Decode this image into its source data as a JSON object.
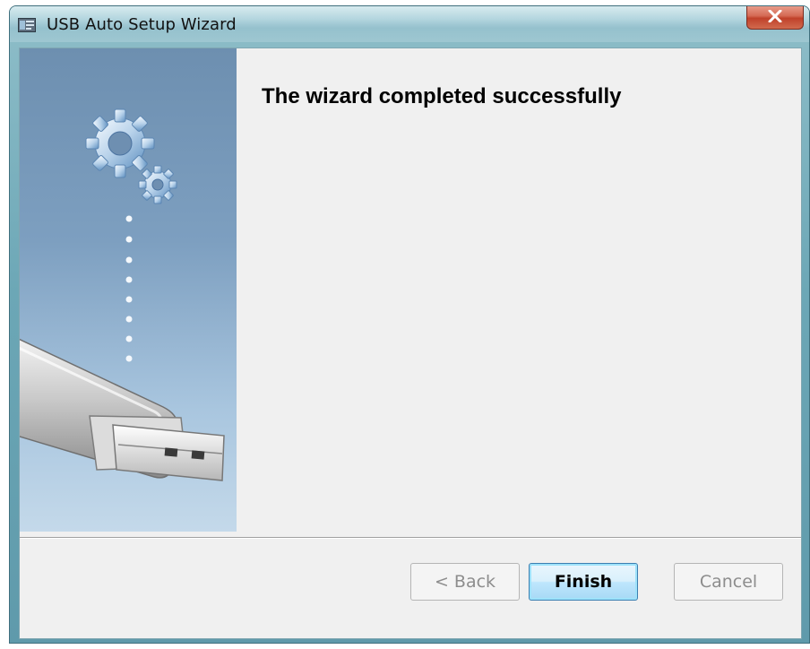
{
  "window": {
    "title": "USB Auto Setup Wizard",
    "title_icon": "wizard-app-icon",
    "close_icon": "close-icon"
  },
  "banner": {
    "gear_icon": "gears-icon",
    "usb_icon": "usb-drive-icon",
    "dots_icon": "progress-dots"
  },
  "content": {
    "heading": "The wizard completed successfully"
  },
  "buttons": {
    "back_label": "< Back",
    "back_enabled": false,
    "finish_label": "Finish",
    "finish_default": true,
    "cancel_label": "Cancel",
    "cancel_enabled": false
  },
  "colors": {
    "titlebar": "#9ec7d1",
    "close_button": "#c0412a",
    "dialog_background": "#f0f0f0",
    "banner_top": "#6d8fb0",
    "banner_bottom": "#c4d9ea",
    "default_button_border": "#3c7fb1"
  }
}
